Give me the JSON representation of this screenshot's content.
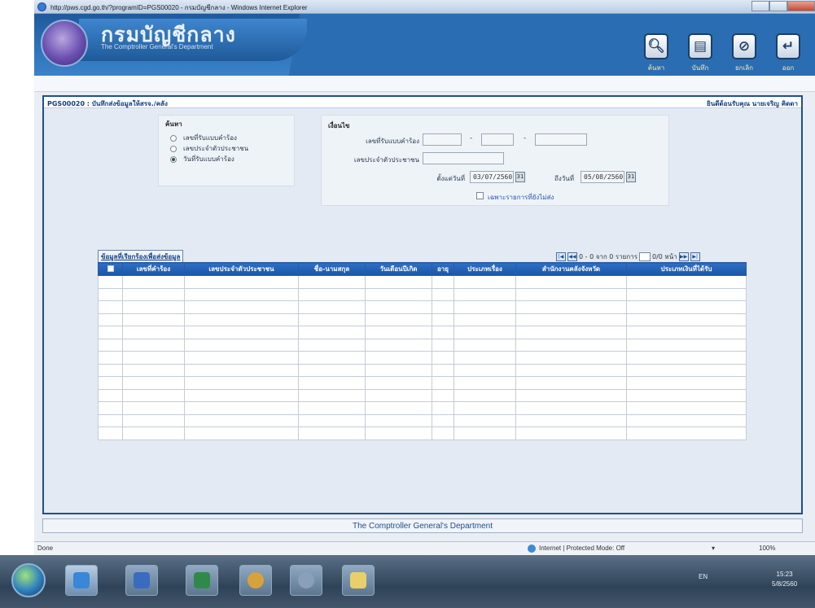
{
  "window": {
    "title": "http://pws.cgd.go.th/?programID=PGS00020 - กรมบัญชีกลาง - Windows Internet Explorer"
  },
  "header": {
    "brand_title": "กรมบัญชีกลาง",
    "brand_subtitle": "The Comptroller General's Department",
    "buttons": [
      {
        "icon": "search-icon",
        "label": "ค้นหา"
      },
      {
        "icon": "save-icon",
        "label": "บันทึก"
      },
      {
        "icon": "cancel-icon",
        "label": "ยกเลิก"
      },
      {
        "icon": "exit-icon",
        "label": "ออก"
      }
    ]
  },
  "content": {
    "program_title": "PGS00020 : บันทึกส่งข้อมูลให้สรจ./คลัง",
    "user_info": "ยินดีต้อนรับคุณ นายเจริญ คิดดา"
  },
  "search": {
    "legend": "ค้นหา",
    "options": [
      {
        "label": "เลขที่รับแบบคำร้อง",
        "selected": false
      },
      {
        "label": "เลขประจำตัวประชาชน",
        "selected": false
      },
      {
        "label": "วันที่รับแบบคำร้อง",
        "selected": true
      }
    ]
  },
  "conditions": {
    "legend": "เงื่อนไข",
    "request_no_label": "เลขที่รับแบบคำร้อง",
    "request_no_parts": [
      "",
      "",
      ""
    ],
    "citizen_id_label": "เลขประจำตัวประชาชน",
    "citizen_id_value": "",
    "start_date_label": "ตั้งแต่วันที่",
    "start_date_value": "03/07/2560",
    "end_date_label": "ถึงวันที่",
    "end_date_value": "05/08/2560",
    "calendar_label": "31",
    "only_unsent_label": "เฉพาะรายการที่ยังไม่ส่ง"
  },
  "results": {
    "title": "ข้อมูลที่เรียกร้องเพื่อส่งข้อมูล",
    "pager_text_1": "0 - 0 จาก 0 รายการ",
    "pager_text_2": "0/0 หน้า",
    "columns": [
      "",
      "เลขที่คำร้อง",
      "เลขประจำตัวประชาชน",
      "ชื่อ-นามสกุล",
      "วันเดือนปีเกิด",
      "อายุ",
      "ประเภทเรื่อง",
      "สำนักงานคลังจังหวัด",
      "ประเภทเงินที่ได้รับ"
    ],
    "empty_rows": 13
  },
  "footer": {
    "text": "The Comptroller General's Department"
  },
  "statusbar": {
    "left": "Done",
    "zone": "Internet | Protected Mode: Off",
    "zoom": "100%"
  },
  "taskbar": {
    "lang": "EN",
    "time": "15:23",
    "date": "5/8/2560"
  }
}
